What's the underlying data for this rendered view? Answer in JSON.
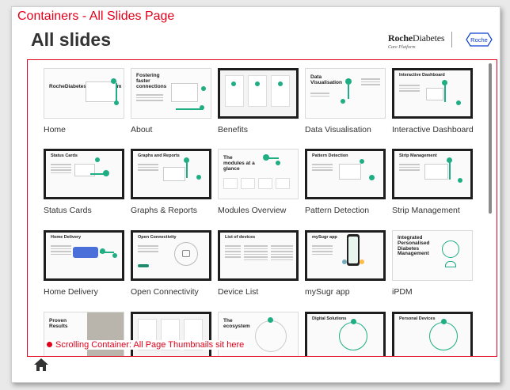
{
  "annotations": {
    "page_label": "Containers - All Slides Page",
    "scroll_label": "Scrolling Container: All Page Thumbnails sit here"
  },
  "header": {
    "title": "All slides",
    "brand_bold": "Roche",
    "brand_light": "Diabetes",
    "brand_sub": "Care Platform",
    "roche_logo_text": "Roche"
  },
  "slides": [
    {
      "label": "Home",
      "thumb_title": "RocheDiabetes Care Platform"
    },
    {
      "label": "About",
      "thumb_title": "Fostering faster connections"
    },
    {
      "label": "Benefits",
      "thumb_title": ""
    },
    {
      "label": "Data Visualisation",
      "thumb_title": "Data Visualisation"
    },
    {
      "label": "Interactive Dashboard",
      "thumb_title": "Interactive Dashboard"
    },
    {
      "label": "Status Cards",
      "thumb_title": "Status Cards"
    },
    {
      "label": "Graphs & Reports",
      "thumb_title": "Graphs and Reports"
    },
    {
      "label": "Modules Overview",
      "thumb_title": "The modules at a glance"
    },
    {
      "label": "Pattern Detection",
      "thumb_title": "Pattern Detection"
    },
    {
      "label": "Strip Management",
      "thumb_title": "Strip Management"
    },
    {
      "label": "Home Delivery",
      "thumb_title": "Home Delivery"
    },
    {
      "label": "Open Connectivity",
      "thumb_title": "Open Connectivity"
    },
    {
      "label": "Device List",
      "thumb_title": "List of devices"
    },
    {
      "label": "mySugr app",
      "thumb_title": "mySugr app"
    },
    {
      "label": "iPDM",
      "thumb_title": "Integrated Personalised Diabetes Management"
    },
    {
      "label": "",
      "thumb_title": "Proven Results"
    },
    {
      "label": "",
      "thumb_title": ""
    },
    {
      "label": "",
      "thumb_title": "The ecosystem"
    },
    {
      "label": "",
      "thumb_title": "Digital Solutions"
    },
    {
      "label": "",
      "thumb_title": "Personal Devices"
    }
  ],
  "icons": {
    "home": "home-icon"
  },
  "colors": {
    "accent_red": "#e2001a",
    "brand_green": "#1fae84",
    "roche_blue": "#0b41cd"
  }
}
